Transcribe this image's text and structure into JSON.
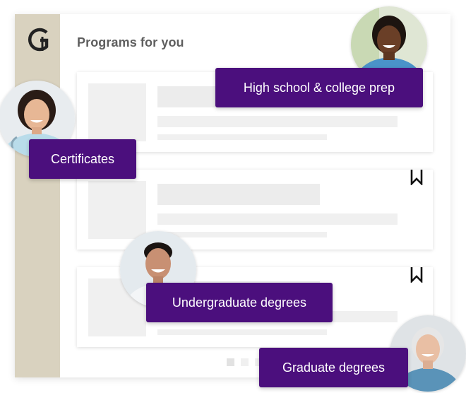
{
  "main": {
    "heading": "Programs for you"
  },
  "tags": {
    "high_school": "High school & college prep",
    "certificates": "Certificates",
    "undergraduate": "Undergraduate degrees",
    "graduate": "Graduate degrees"
  },
  "icons": {
    "logo": "institution-logo-icon",
    "bookmark": "bookmark-icon"
  },
  "colors": {
    "sidebar": "#d9d2bf",
    "tag_background": "#4b0f7d",
    "tag_text": "#ffffff",
    "placeholder": "#ececec",
    "heading": "#5f5f5f"
  },
  "pagination": {
    "page_count": 3,
    "active_index": 0
  }
}
